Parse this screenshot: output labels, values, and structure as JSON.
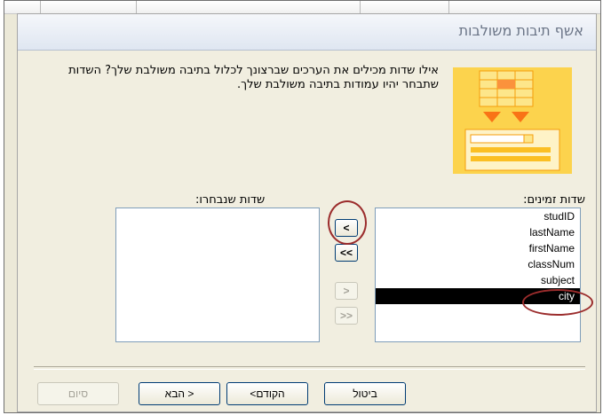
{
  "wizard": {
    "title": "אשף תיבות משולבות",
    "description": "אילו שדות מכילים את הערכים שברצונך לכלול בתיבה משולבת שלך? השדות שתבחר יהיו עמודות בתיבה משולבת שלך."
  },
  "available": {
    "label": "שדות זמינים:",
    "items": [
      "studID",
      "lastName",
      "firstName",
      "classNum",
      "subject",
      "city"
    ],
    "selected_item": "city"
  },
  "selected": {
    "label": "שדות שנבחרו:",
    "items": []
  },
  "move_buttons": {
    "add_one": "<",
    "add_all": "<<",
    "remove_one": ">",
    "remove_all": ">>"
  },
  "footer": {
    "cancel": "ביטול",
    "back": "<הקודם",
    "next": "הבא >",
    "finish": "סיום"
  },
  "colors": {
    "annotation_circle": "#9b2c2c",
    "selection": "#000000",
    "icon_yellow": "#fcd34d"
  }
}
